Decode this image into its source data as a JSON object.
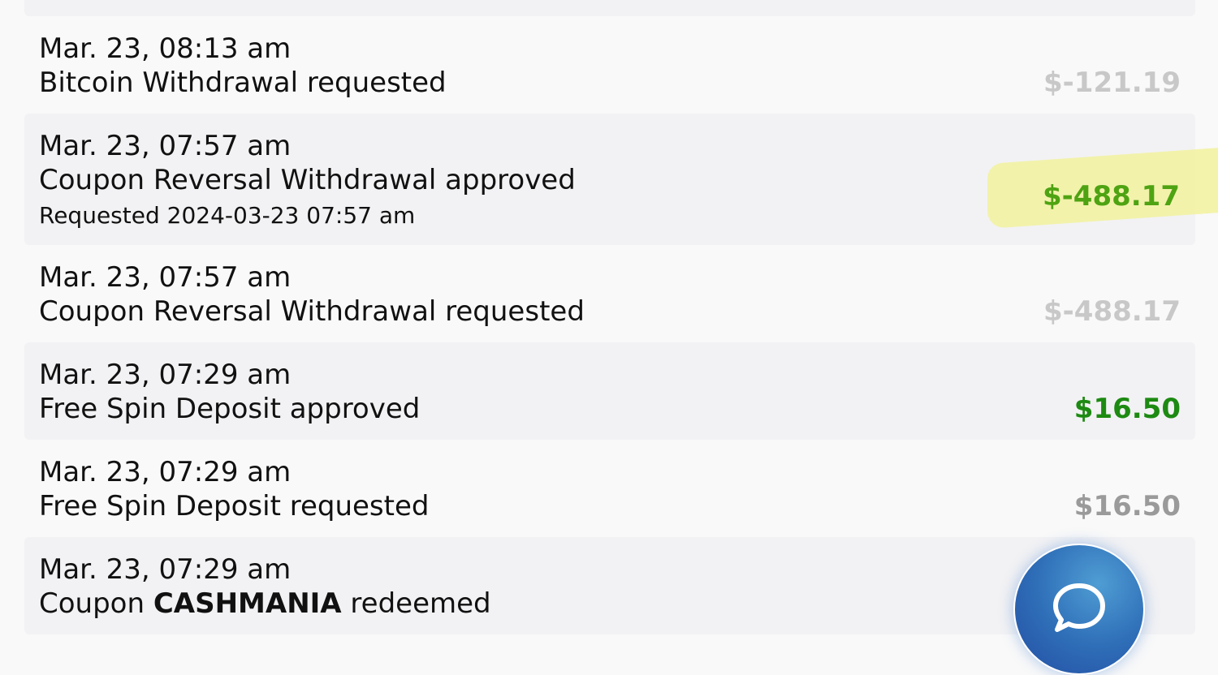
{
  "colors": {
    "page_background": "#f9f9f9",
    "row_shaded": "#f2f2f4",
    "amount_pending": "#c8c8c8",
    "amount_approved": "#1d8a12",
    "amount_reversal_approved": "#4ea312",
    "amount_neutral": "#9a9a9a",
    "highlight": "#f2f29e",
    "chat_button": "#2f6fb8"
  },
  "transactions": [
    {
      "date": "",
      "description": "",
      "amount": ""
    },
    {
      "date": "Mar. 23, 08:13 am",
      "description": "Bitcoin Withdrawal requested",
      "amount": "$-121.19",
      "status": "requested"
    },
    {
      "date": "Mar. 23, 07:57 am",
      "description": "Coupon Reversal Withdrawal approved",
      "detail": "Requested 2024-03-23 07:57 am",
      "amount": "$-488.17",
      "status": "approved",
      "highlighted": true
    },
    {
      "date": "Mar. 23, 07:57 am",
      "description": "Coupon Reversal Withdrawal requested",
      "amount": "$-488.17",
      "status": "requested"
    },
    {
      "date": "Mar. 23, 07:29 am",
      "description": "Free Spin Deposit approved",
      "amount": "$16.50",
      "status": "approved"
    },
    {
      "date": "Mar. 23, 07:29 am",
      "description": "Free Spin Deposit requested",
      "amount": "$16.50",
      "status": "requested"
    },
    {
      "date": "Mar. 23, 07:29 am",
      "description_prefix": "Coupon ",
      "coupon_code": "CASHMANIA",
      "description_suffix": " redeemed",
      "amount": ""
    }
  ],
  "chat_button": {
    "icon": "chat-bubble-icon"
  }
}
